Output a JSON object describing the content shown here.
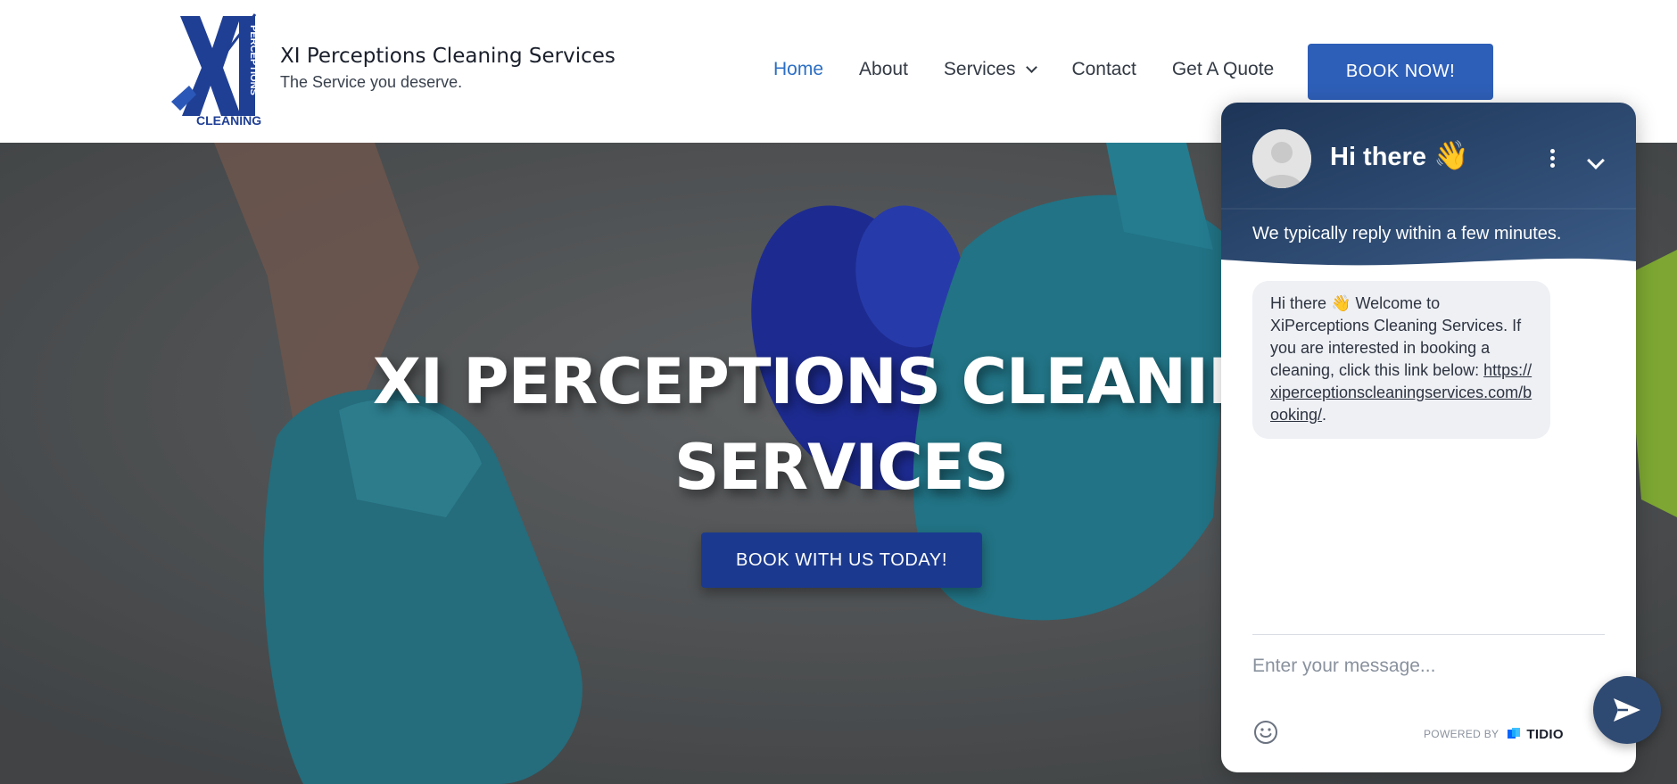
{
  "header": {
    "brand_title": "XI Perceptions Cleaning Services",
    "brand_tagline": "The Service you deserve.",
    "logo_icon": "xi-perceptions-cleaning-logo",
    "nav": [
      {
        "label": "Home",
        "active": true
      },
      {
        "label": "About",
        "active": false
      },
      {
        "label": "Services",
        "active": false,
        "dropdown": true
      },
      {
        "label": "Contact",
        "active": false
      },
      {
        "label": "Get A Quote",
        "active": false
      }
    ],
    "book_now_label": "BOOK NOW!"
  },
  "hero": {
    "title_line1": "XI PERCEPTIONS CLEANING",
    "title_line2": "SERVICES",
    "cta_label": "BOOK WITH US TODAY!"
  },
  "chat": {
    "title": "Hi there",
    "title_emoji": "👋",
    "reply_time": "We typically reply within a few minutes.",
    "message_prefix": "Hi there",
    "message_emoji": "👋",
    "message_text": "Welcome to XiPerceptions Cleaning Services. If you are interested in booking a cleaning, click this link below:",
    "message_link": "https://xiperceptionscleaningservices.com/booking/",
    "message_suffix": ".",
    "input_placeholder": "Enter your message...",
    "powered_by": "POWERED BY",
    "brand": "TIDIO"
  },
  "colors": {
    "accent": "#2e5fb8",
    "hero_button": "#1b3a8f",
    "chat_header": "#2f4a72",
    "nav_active": "#2c6fc4"
  }
}
